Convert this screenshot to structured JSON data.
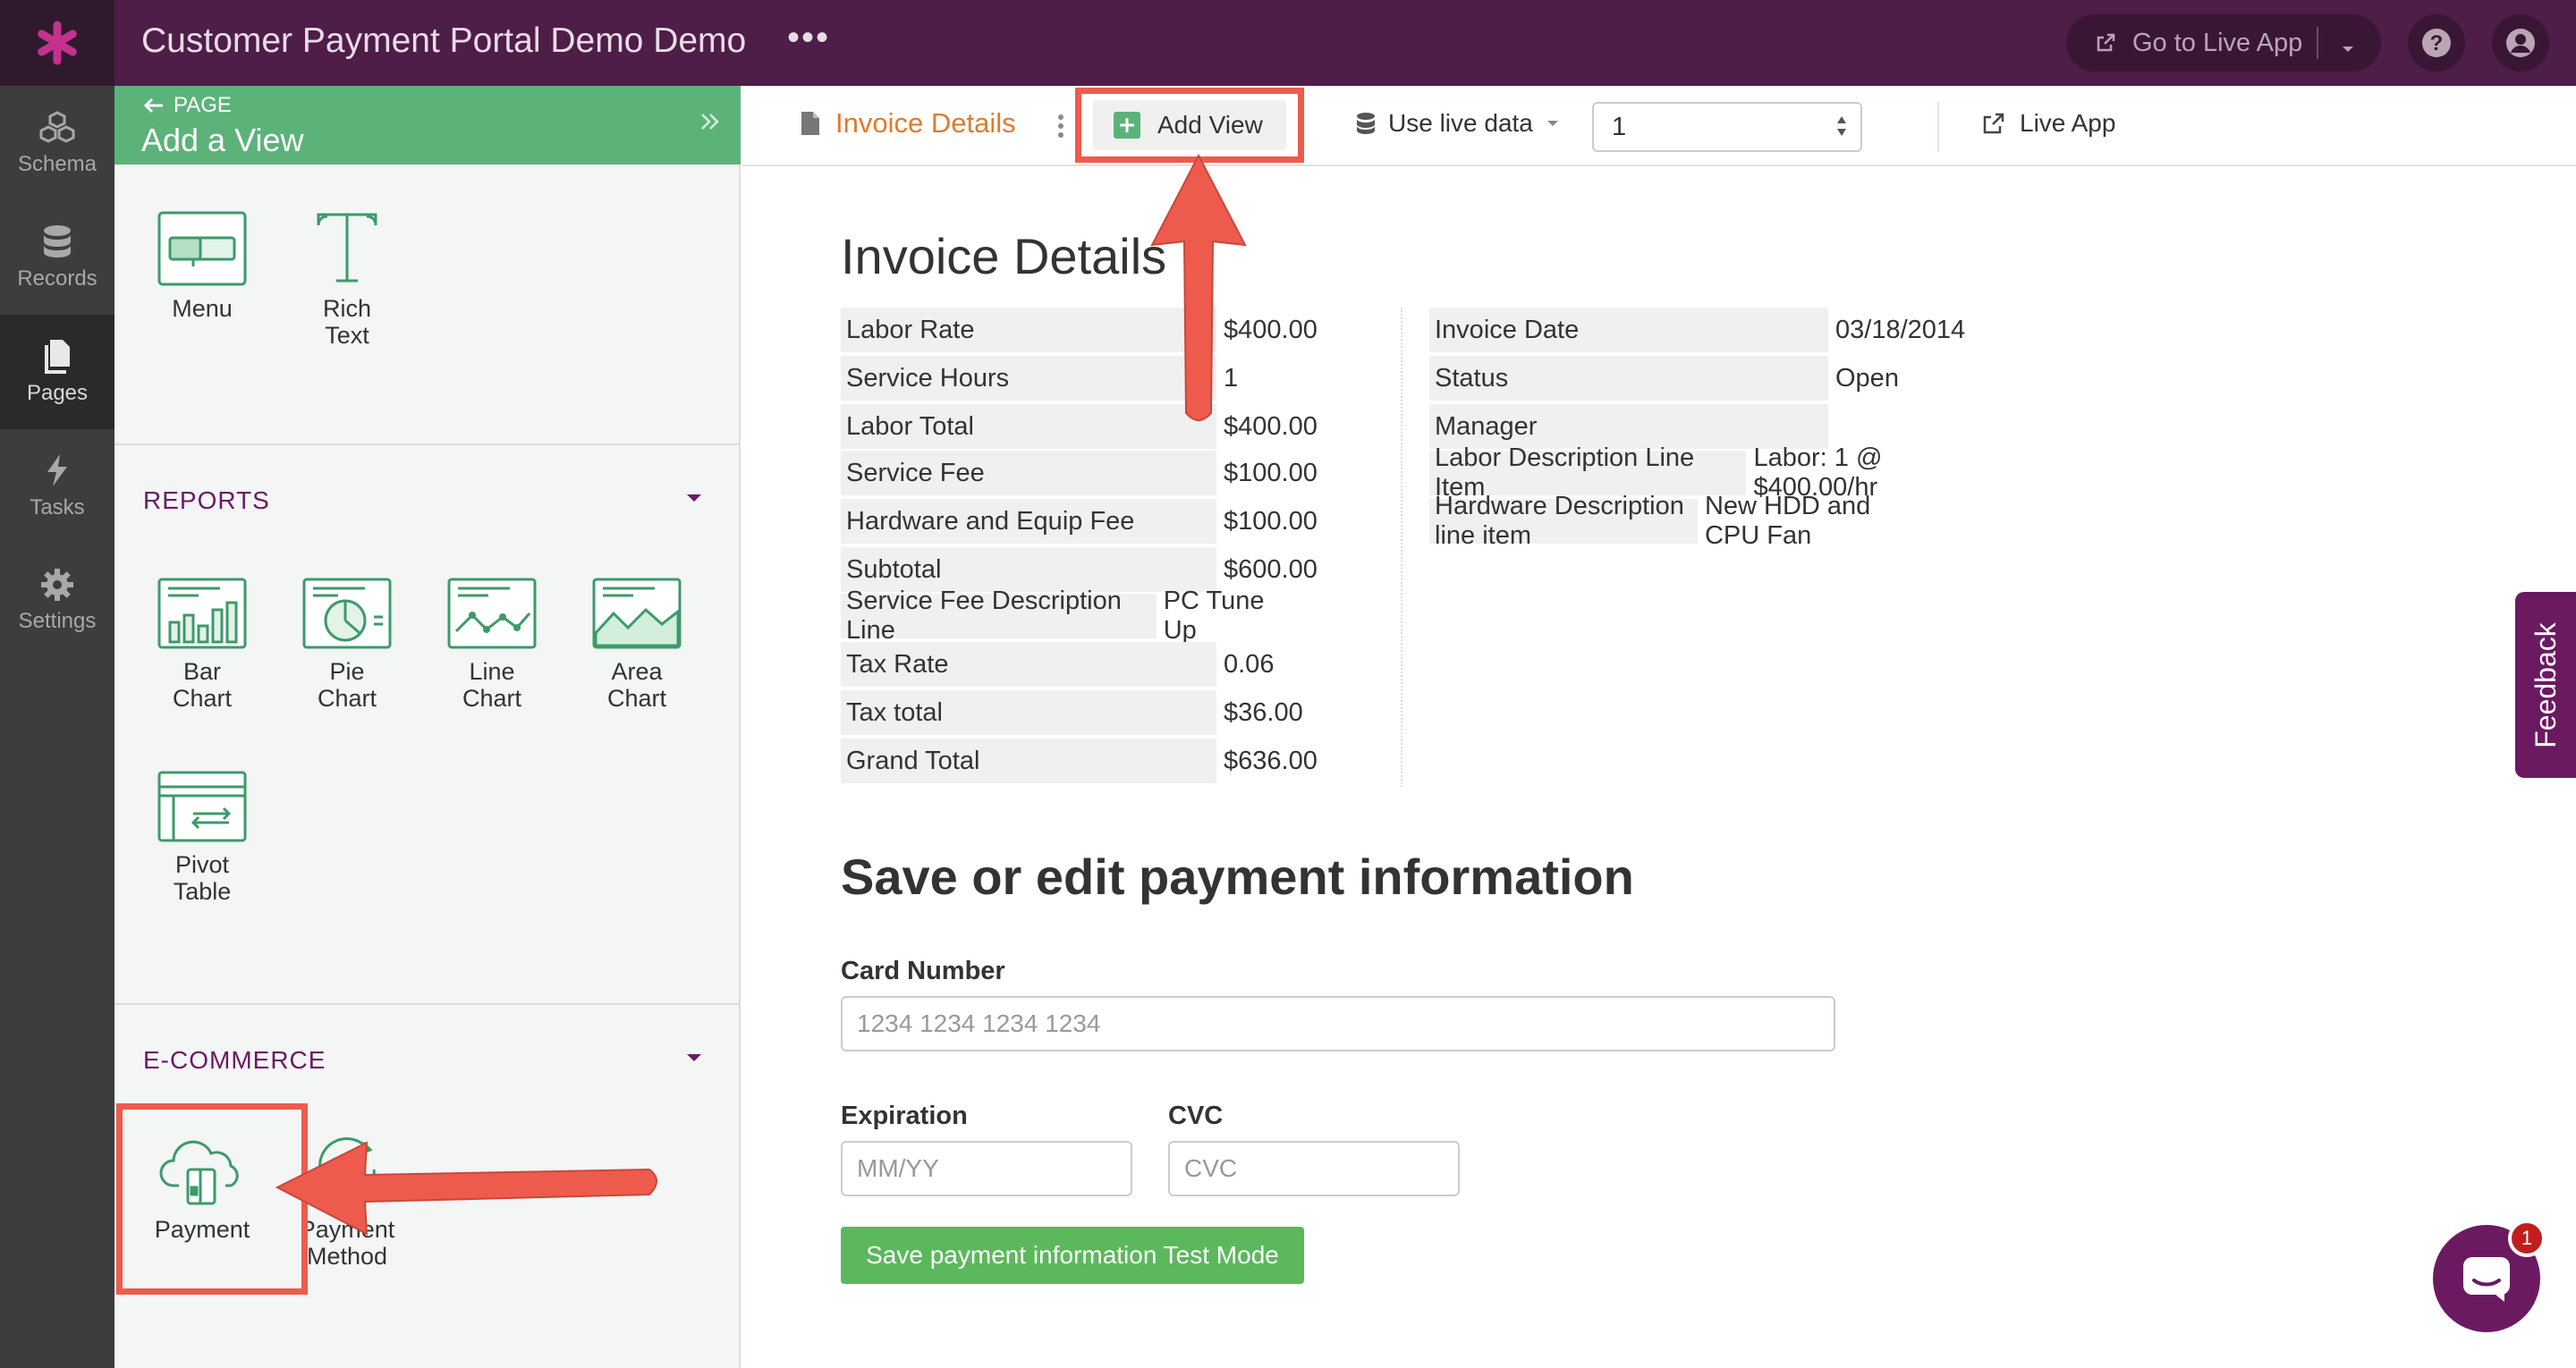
{
  "app": {
    "title": "Customer Payment Portal Demo Demo",
    "more_label": "•••",
    "go_live_label": "Go to Live App",
    "accent": "#4e1d48"
  },
  "nav": {
    "items": [
      {
        "label": "Schema",
        "icon": "schema-icon"
      },
      {
        "label": "Records",
        "icon": "database-icon"
      },
      {
        "label": "Pages",
        "icon": "pages-icon"
      },
      {
        "label": "Tasks",
        "icon": "bolt-icon"
      },
      {
        "label": "Settings",
        "icon": "gear-icon"
      }
    ],
    "active": "Pages"
  },
  "panel": {
    "back_label": "PAGE",
    "title": "Add a View",
    "basic_tiles": [
      {
        "label1": "Menu",
        "label2": ""
      },
      {
        "label1": "Rich",
        "label2": "Text"
      }
    ],
    "reports": {
      "title": "REPORTS",
      "tiles": [
        {
          "label1": "Bar",
          "label2": "Chart"
        },
        {
          "label1": "Pie",
          "label2": "Chart"
        },
        {
          "label1": "Line",
          "label2": "Chart"
        },
        {
          "label1": "Area",
          "label2": "Chart"
        },
        {
          "label1": "Pivot",
          "label2": "Table"
        }
      ]
    },
    "ecommerce": {
      "title": "E-COMMERCE",
      "tiles": [
        {
          "label1": "Payment",
          "label2": ""
        },
        {
          "label1": "Payment",
          "label2": "Method"
        }
      ]
    }
  },
  "toolbar": {
    "page_name": "Invoice Details",
    "add_view_label": "Add View",
    "live_data_label": "Use live data",
    "record_value": "1",
    "live_app_label": "Live App"
  },
  "invoice": {
    "heading": "Invoice Details",
    "left_fields": [
      {
        "label": "Labor Rate",
        "value": "$400.00"
      },
      {
        "label": "Service Hours",
        "value": "1"
      },
      {
        "label": "Labor Total",
        "value": "$400.00"
      },
      {
        "label": "Service Fee",
        "value": "$100.00"
      },
      {
        "label": "Hardware and Equip Fee",
        "value": "$100.00"
      },
      {
        "label": "Subtotal",
        "value": "$600.00"
      },
      {
        "label": "Service Fee Description Line",
        "value": "PC Tune Up"
      },
      {
        "label": "Tax Rate",
        "value": "0.06"
      },
      {
        "label": "Tax total",
        "value": "$36.00"
      },
      {
        "label": "Grand Total",
        "value": "$636.00"
      }
    ],
    "right_fields": [
      {
        "label": "Invoice Date",
        "value": "03/18/2014"
      },
      {
        "label": "Status",
        "value": "Open"
      },
      {
        "label": "Manager",
        "value": ""
      },
      {
        "label": "Labor Description Line Item",
        "value": "Labor: 1 @ $400.00/hr"
      },
      {
        "label": "Hardware Description line item",
        "value": "New HDD and CPU Fan"
      }
    ]
  },
  "payment_form": {
    "heading": "Save or edit payment information",
    "card_label": "Card Number",
    "card_placeholder": "1234 1234 1234 1234",
    "exp_label": "Expiration",
    "exp_placeholder": "MM/YY",
    "cvc_label": "CVC",
    "cvc_placeholder": "CVC",
    "save_label": "Save payment information Test Mode"
  },
  "feedback_label": "Feedback",
  "chat_badge": "1",
  "colors": {
    "brand_purple": "#4e1d48",
    "green": "#5cb37a",
    "annotation_red": "#ee5b4d",
    "link_orange": "#e07a2c"
  }
}
